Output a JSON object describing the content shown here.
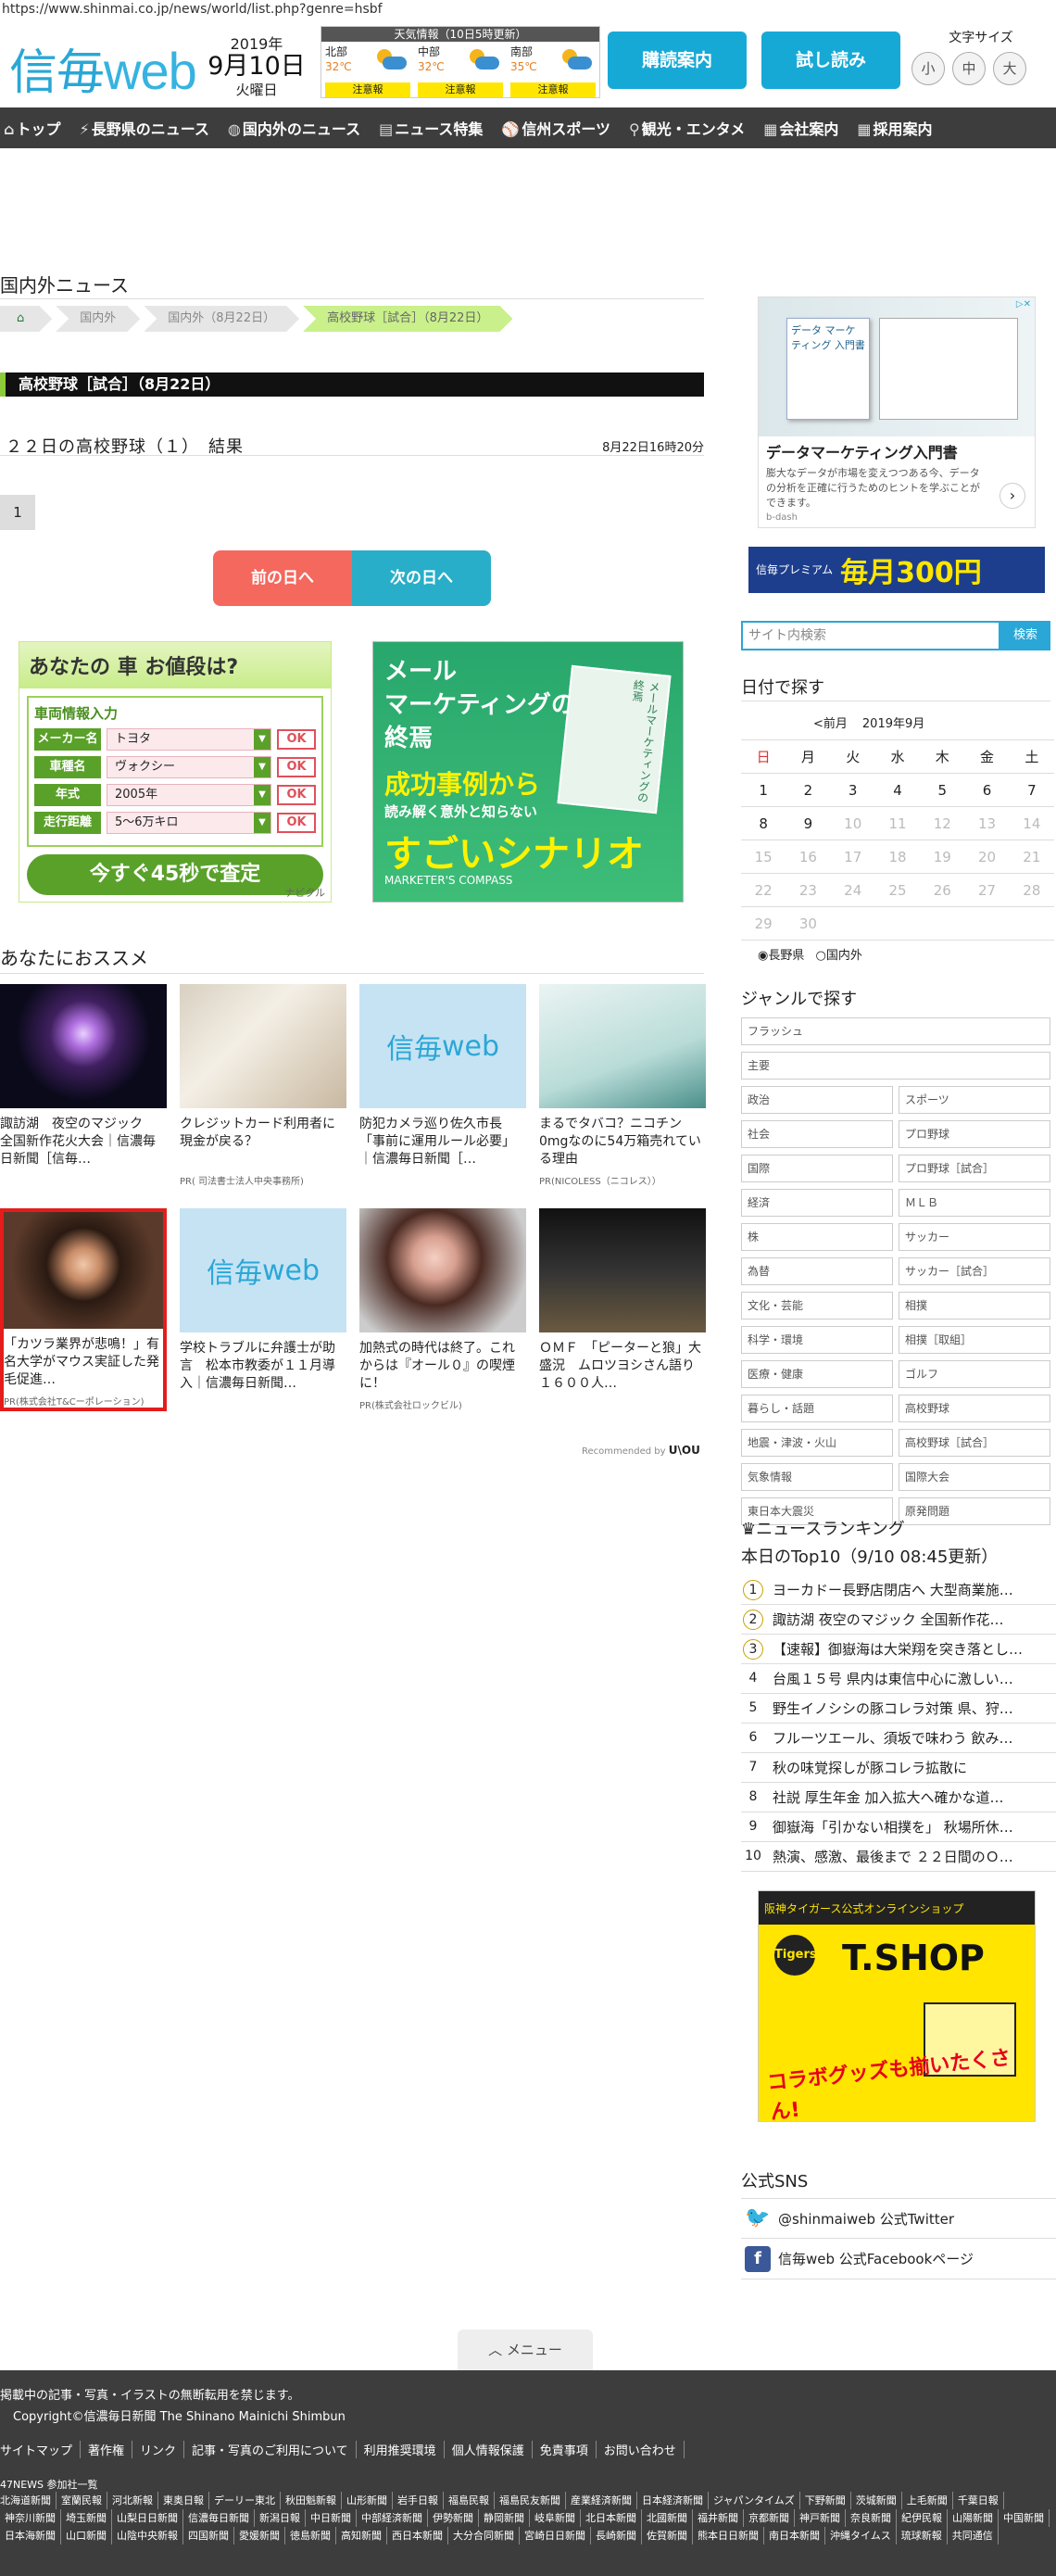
{
  "url": "https://www.shinmai.co.jp/news/world/list.php?genre=hsbf",
  "header": {
    "logo_a": "信毎",
    "logo_b": "web",
    "date_year": "2019年",
    "date_md": "9月10日",
    "date_wd": "火曜日",
    "weather_title": "天気情報（10日5時更新）",
    "weather": [
      {
        "region": "北部",
        "temp": "32℃",
        "warn": "注意報"
      },
      {
        "region": "中部",
        "temp": "32℃",
        "warn": "注意報"
      },
      {
        "region": "南部",
        "temp": "35℃",
        "warn": "注意報"
      }
    ],
    "btn_subscribe": "購読案内",
    "btn_trial": "試し読み",
    "fontsize_label": "文字サイズ",
    "fontsize_small": "小",
    "fontsize_medium": "中",
    "fontsize_large": "大"
  },
  "nav": [
    {
      "icon": "⌂",
      "label": "トップ"
    },
    {
      "icon": "⚡",
      "label": "長野県のニュース"
    },
    {
      "icon": "◍",
      "label": "国内外のニュース"
    },
    {
      "icon": "▤",
      "label": "ニュース特集"
    },
    {
      "icon": "⚾",
      "label": "信州スポーツ"
    },
    {
      "icon": "⚲",
      "label": "観光・エンタメ"
    },
    {
      "icon": "▦",
      "label": "会社案内"
    },
    {
      "icon": "▦",
      "label": "採用案内"
    }
  ],
  "main": {
    "section_title": "国内外ニュース",
    "breadcrumb": [
      "国内外",
      "国内外（8月22日）",
      "高校野球［試合］（8月22日）"
    ],
    "band": "高校野球［試合］（8月22日）",
    "article_title": "２２日の高校野球（１）　結果",
    "article_time": "8月22日16時20分",
    "page_num": "1",
    "prev_day": "前の日へ",
    "next_day": "次の日へ"
  },
  "ad_car": {
    "head": "あなたの 車 お値段は?",
    "car": "車",
    "form_title": "車両情報入力",
    "rows": [
      {
        "label": "メーカー名",
        "value": "トヨタ",
        "ok": "OK"
      },
      {
        "label": "車種名",
        "value": "ヴォクシー",
        "ok": "OK"
      },
      {
        "label": "年式",
        "value": "2005年",
        "ok": "OK"
      },
      {
        "label": "走行距離",
        "value": "5～6万キロ",
        "ok": "OK"
      }
    ],
    "cta": "今すぐ45秒で査定",
    "brand": "ナビクル"
  },
  "ad_mkt": {
    "line1": "メール",
    "line2": "マーケティングの",
    "line3": "終焉",
    "line4": "成功事例から",
    "line5": "読み解く意外と知らない",
    "line6": "すごいシナリオ",
    "brand": "MARKETER'S COMPASS",
    "book": "メールマーケティングの終焉"
  },
  "recommend": {
    "title": "あなたにおススメ",
    "items": [
      {
        "text": "諏訪湖　夜空のマジック　全国新作花火大会｜信濃毎日新聞［信毎…",
        "pr": ""
      },
      {
        "text": "クレジットカード利用者に現金が戻る？",
        "pr": "PR( 司法書士法人中央事務所)"
      },
      {
        "text": "防犯カメラ巡り佐久市長「事前に運用ルール必要」｜信濃毎日新聞［…",
        "pr": ""
      },
      {
        "text": "まるでタバコ？ニコチン0mgなのに54万箱売れている理由",
        "pr": "PR(NICOLESS（ニコレス））"
      },
      {
        "text": "「カツラ業界が悲鳴！」有名大学がマウス実証した発毛促進…",
        "pr": "PR(株式会社T&Cーポレーション)"
      },
      {
        "text": "学校トラブルに弁護士が助言　松本市教委が１１月導入｜信濃毎日新聞…",
        "pr": ""
      },
      {
        "text": "加熱式の時代は終了。これからは『オール０』の喫煙に！",
        "pr": "PR(株式会社ロックビル)"
      },
      {
        "text": "ＯＭＦ　「ピーターと狼」大盛況　ムロツヨシさん語り　１６００人…",
        "pr": ""
      }
    ],
    "powered_a": "Recommended by",
    "powered_b": "U\\OU"
  },
  "side": {
    "ad_title": "データマーケティング入門書",
    "ad_desc": "膨大なデータが市場を変えつつある今、データの分析を正確に行うためのヒントを学ぶことができます。",
    "ad_src": "b-dash",
    "ad_book": "データ マーケティング 入門書",
    "prem_a": "信毎プレミアム",
    "prem_b": "毎月300円",
    "search_placeholder": "サイト内検索",
    "search_btn": "検索",
    "date_title": "日付で探す",
    "cal_prev": "<前月",
    "cal_month": "2019年9月",
    "weekdays": [
      "日",
      "月",
      "火",
      "水",
      "木",
      "金",
      "土"
    ],
    "weeks": [
      [
        "1",
        "2",
        "3",
        "4",
        "5",
        "6",
        "7"
      ],
      [
        "8",
        "9",
        "10",
        "11",
        "12",
        "13",
        "14"
      ],
      [
        "15",
        "16",
        "17",
        "18",
        "19",
        "20",
        "21"
      ],
      [
        "22",
        "23",
        "24",
        "25",
        "26",
        "27",
        "28"
      ],
      [
        "29",
        "30",
        "",
        "",
        "",
        "",
        ""
      ]
    ],
    "radio_a": "長野県",
    "radio_b": "国内外",
    "genre_title": "ジャンルで探す",
    "genre_full": [
      "フラッシュ",
      "主要"
    ],
    "genres": [
      "政治",
      "スポーツ",
      "社会",
      "プロ野球",
      "国際",
      "プロ野球［試合］",
      "経済",
      "ＭＬＢ",
      "株",
      "サッカー",
      "為替",
      "サッカー［試合］",
      "文化・芸能",
      "相撲",
      "科学・環境",
      "相撲［取組］",
      "医療・健康",
      "ゴルフ",
      "暮らし・話題",
      "高校野球",
      "地震・津波・火山",
      "高校野球［試合］",
      "気象情報",
      "国際大会",
      "東日本大震災",
      "原発問題"
    ],
    "rank_title": "ニュースランキング",
    "rank_sub": "本日のTop10（9/10 08:45更新）",
    "ranking": [
      "ヨーカドー長野店閉店へ 大型商業施…",
      "諏訪湖 夜空のマジック 全国新作花…",
      "【速報】御嶽海は大栄翔を突き落とし…",
      "台風１５号 県内は東信中心に激しい…",
      "野生イノシシの豚コレラ対策 県、狩…",
      "フルーツエール、須坂で味わう 飲み…",
      "秋の味覚探しが豚コレラ拡散に",
      "社説 厚生年金 加入拡大へ確かな道…",
      "御嶽海「引かない相撲を」 秋場所休…",
      "熱演、感激、最後まで ２２日間のＯ…"
    ],
    "tigers_top": "阪神タイガース公式オンラインショップ",
    "tigers_logo": "Tigers",
    "tigers_shop": "T.SHOP",
    "tigers_bottom": "コラボグッズも揃いたくさん!",
    "sns_title": "公式SNS",
    "sns_twitter": "@shinmaiweb 公式Twitter",
    "sns_facebook": "信毎web 公式Facebookページ"
  },
  "footer": {
    "menu": "メニュー",
    "notice": "掲載中の記事・写真・イラストの無断転用を禁じます。",
    "copyright": "Copyright©信濃毎日新聞 The Shinano Mainichi Shimbun",
    "links": [
      "サイトマップ",
      "著作権",
      "リンク",
      "記事・写真のご利用について",
      "利用推奨環境",
      "個人情報保護",
      "免責事項",
      "お問い合わせ"
    ],
    "news47_title": "47NEWS 参加社一覧",
    "papers": [
      "北海道新聞",
      "室蘭民報",
      "河北新報",
      "東奥日報",
      "デーリー東北",
      "秋田魁新報",
      "山形新聞",
      "岩手日報",
      "福島民報",
      "福島民友新聞",
      "産業経済新聞",
      "日本経済新聞",
      "ジャパンタイムズ",
      "下野新聞",
      "茨城新聞",
      "上毛新聞",
      "千葉日報",
      "神奈川新聞",
      "埼玉新聞",
      "山梨日日新聞",
      "信濃毎日新聞",
      "新潟日報",
      "中日新聞",
      "中部経済新聞",
      "伊勢新聞",
      "静岡新聞",
      "岐阜新聞",
      "北日本新聞",
      "北國新聞",
      "福井新聞",
      "京都新聞",
      "神戸新聞",
      "奈良新聞",
      "紀伊民報",
      "山陽新聞",
      "中国新聞",
      "日本海新聞",
      "山口新聞",
      "山陰中央新報",
      "四国新聞",
      "愛媛新聞",
      "徳島新聞",
      "高知新聞",
      "西日本新聞",
      "大分合同新聞",
      "宮崎日日新聞",
      "長崎新聞",
      "佐賀新聞",
      "熊本日日新聞",
      "南日本新聞",
      "沖縄タイムス",
      "琉球新報",
      "共同通信"
    ]
  }
}
